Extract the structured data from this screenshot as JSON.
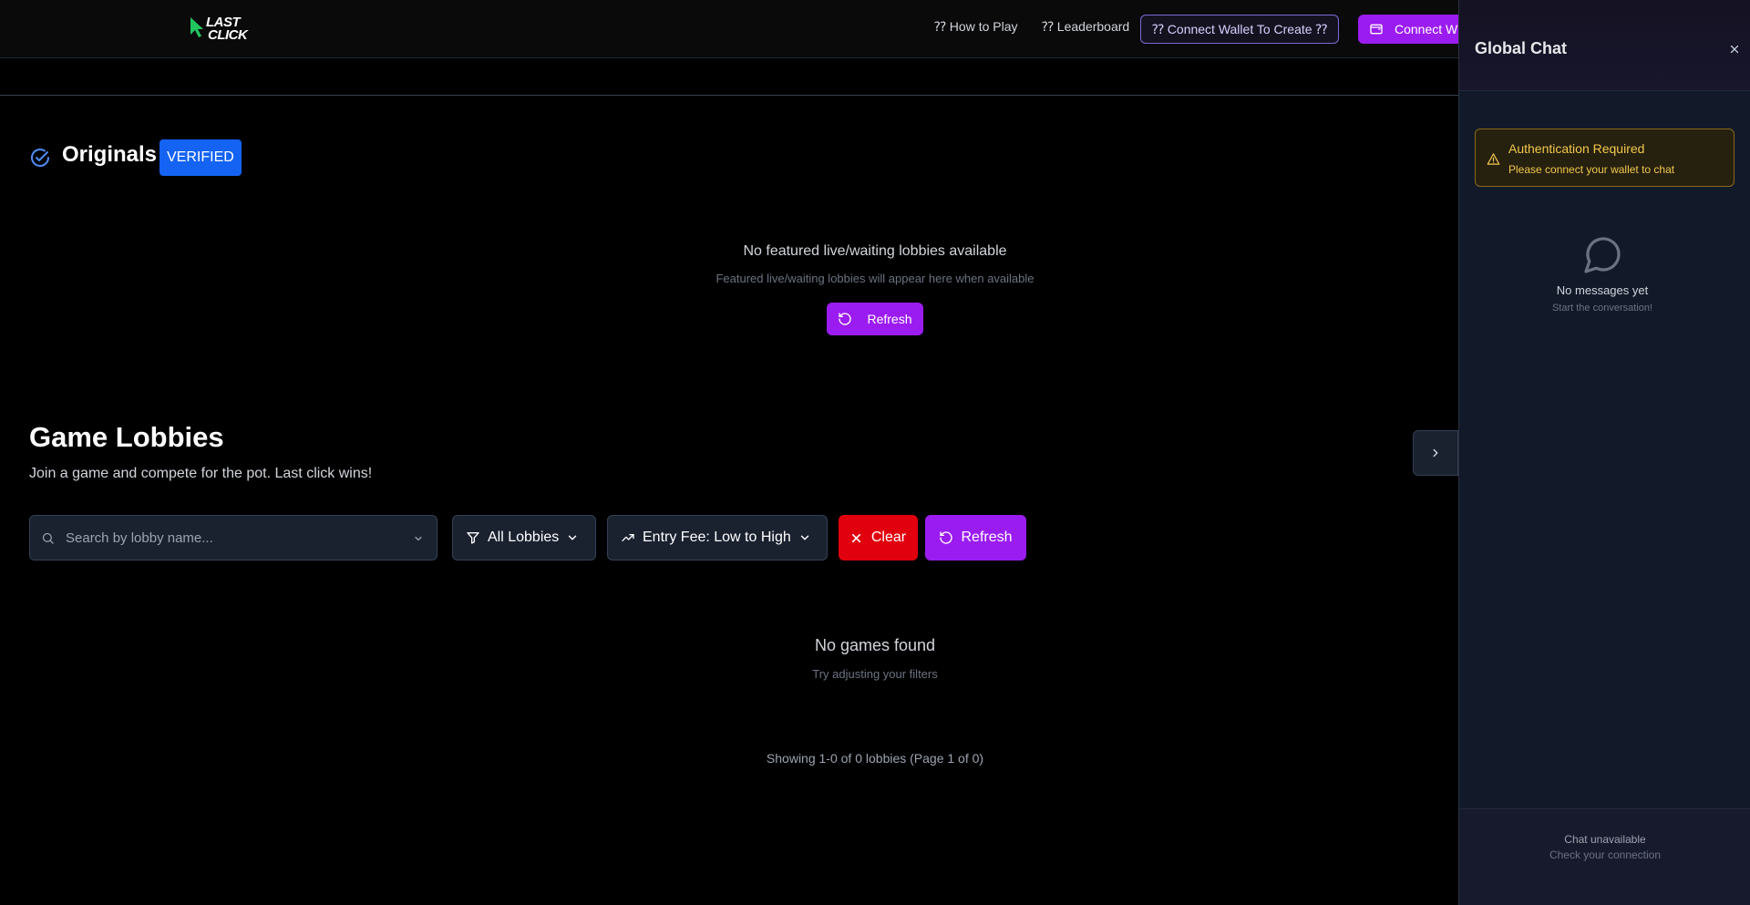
{
  "header": {
    "logo_line1": "LAST",
    "logo_line2": "CLICK",
    "nav": {
      "how_to_play": "⁇ How to Play",
      "leaderboard": "⁇ Leaderboard",
      "connect_create": "⁇ Connect Wallet To Create ⁇",
      "connect_wallet": "Connect W"
    }
  },
  "originals": {
    "title": "Originals",
    "badge": "VERIFIED",
    "empty_title": "No featured live/waiting lobbies available",
    "empty_sub": "Featured live/waiting lobbies will appear here when available",
    "refresh_label": "Refresh"
  },
  "lobbies": {
    "title": "Game Lobbies",
    "subtitle": "Join a game and compete for the pot. Last click wins!",
    "search_placeholder": "Search by lobby name...",
    "filter_label": "All Lobbies",
    "sort_label": "Entry Fee: Low to High",
    "clear_label": "Clear",
    "refresh_label": "Refresh",
    "empty_title": "No games found",
    "empty_sub": "Try adjusting your filters",
    "pagination": "Showing 1-0 of 0 lobbies (Page 1 of 0)"
  },
  "chat": {
    "title": "Global Chat",
    "auth_title": "Authentication Required",
    "auth_msg": "Please connect your wallet to chat",
    "empty_title": "No messages yet",
    "empty_sub": "Start the conversation!",
    "footer_1": "Chat unavailable",
    "footer_2": "Check your connection"
  },
  "colors": {
    "accent_purple": "#9b1cf0",
    "verified_blue": "#1463f3",
    "clear_red": "#e1000e",
    "warning_yellow": "#f2c94c",
    "logo_green": "#22c55e"
  },
  "icons": [
    "cursor-logo-icon",
    "wallet-icon",
    "check-circle-icon",
    "refresh-icon",
    "search-icon",
    "chevron-down-icon",
    "filter-icon",
    "trending-up-icon",
    "x-icon",
    "chevron-right-icon",
    "close-icon",
    "warning-icon",
    "message-circle-icon"
  ]
}
